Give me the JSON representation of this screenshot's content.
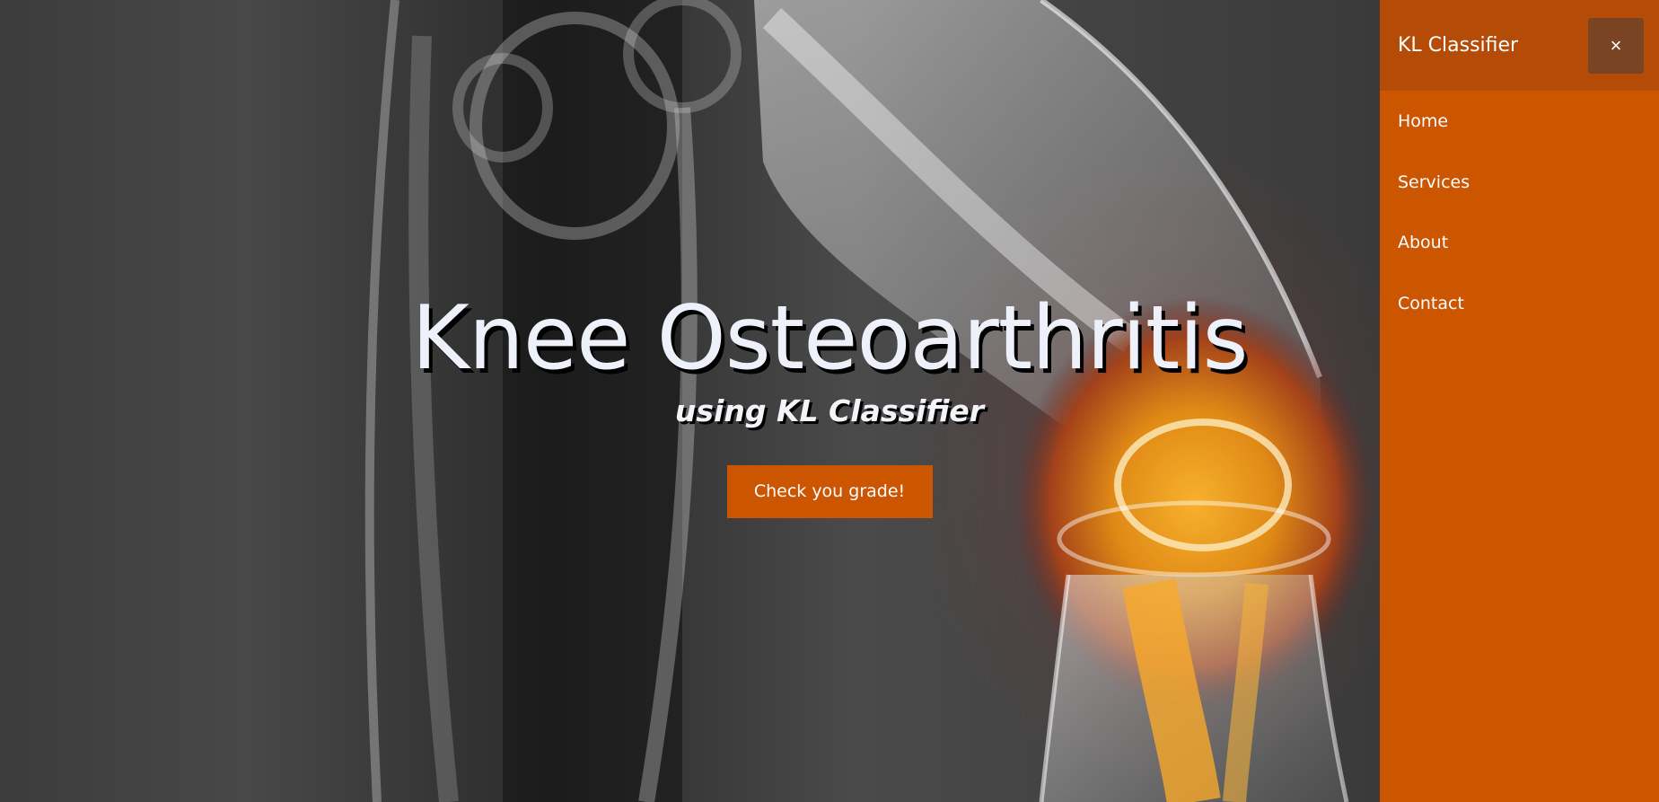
{
  "hero": {
    "title": "Knee Osteoarthritis",
    "subtitle": "using KL Classifier",
    "cta_label": "Check you grade!"
  },
  "sidenav": {
    "brand": "KL Classifier",
    "close_label": "×",
    "items": [
      {
        "label": "Home"
      },
      {
        "label": "Services"
      },
      {
        "label": "About"
      },
      {
        "label": "Contact"
      }
    ]
  },
  "colors": {
    "accent": "#cc5500",
    "header": "#b44c07",
    "close_button": "#7a4424"
  }
}
